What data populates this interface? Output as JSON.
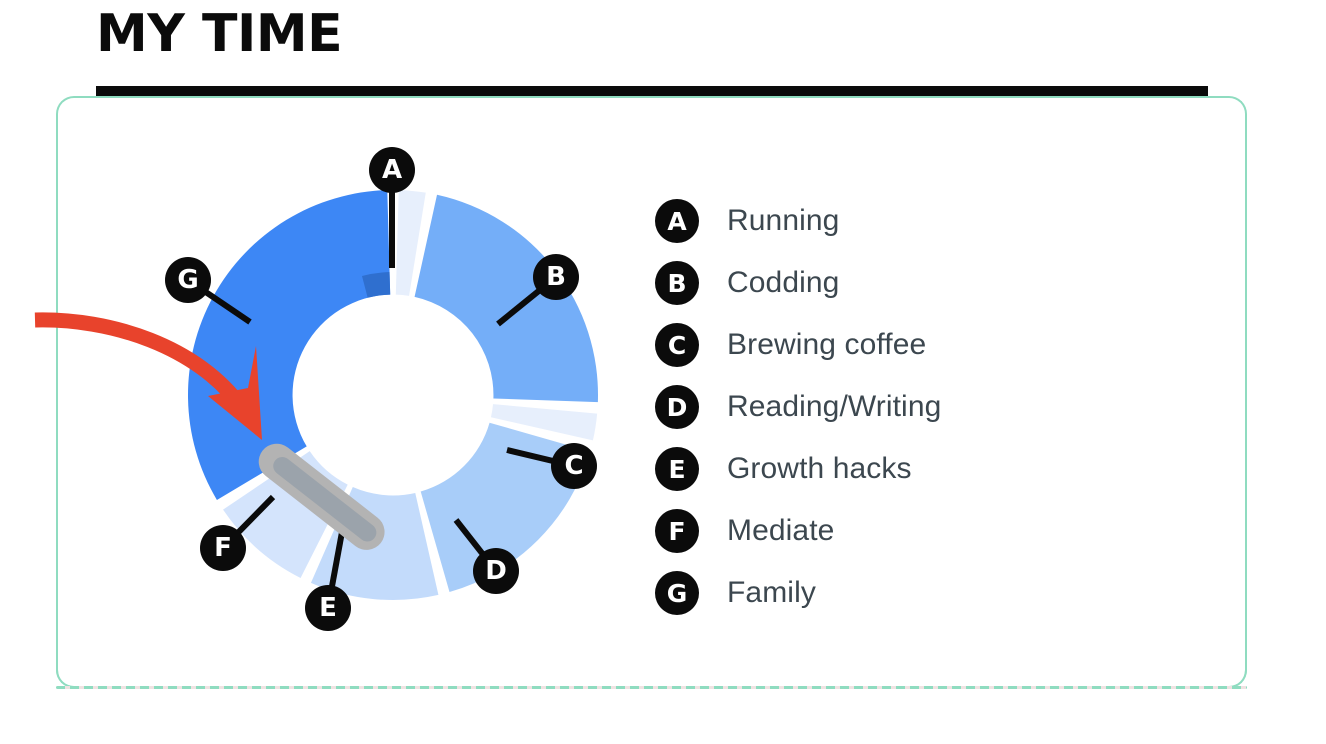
{
  "header": {
    "title": "MY TIME",
    "rule_color": "#0b0b0b"
  },
  "card": {
    "border_color": "#8fdcc0",
    "background": "#ffffff"
  },
  "legend": {
    "text_color": "#3c474f",
    "badge_color": "#0b0b0b",
    "items": [
      {
        "key": "A",
        "label": "Running"
      },
      {
        "key": "B",
        "label": "Codding"
      },
      {
        "key": "C",
        "label": "Brewing coffee"
      },
      {
        "key": "D",
        "label": "Reading/Writing"
      },
      {
        "key": "E",
        "label": "Growth hacks"
      },
      {
        "key": "F",
        "label": "Mediate"
      },
      {
        "key": "G",
        "label": "Family"
      }
    ]
  },
  "annotations": {
    "arrow": {
      "name": "red-curved-arrow",
      "color": "#e8432c",
      "points_to": "F"
    },
    "handle": {
      "name": "drag-handle-pill",
      "color": "#b3b3b3",
      "inner_color": "#8d9aa6",
      "at_boundary": "G/F"
    }
  },
  "chart_data": {
    "type": "pie",
    "title": "MY TIME",
    "variant": "donut",
    "legend_position": "right",
    "start_angle_deg": -90,
    "gap_deg": 3.2,
    "inner_radius_ratio": 0.49,
    "categories": [
      "Running",
      "Codding",
      "Brewing coffee",
      "Reading/Writing",
      "Growth hacks",
      "Mediate",
      "Family"
    ],
    "keys": [
      "A",
      "B",
      "C",
      "D",
      "E",
      "F",
      "G"
    ],
    "values": [
      3,
      23,
      3,
      17,
      11,
      9,
      34
    ],
    "unit": "%",
    "colors": [
      "#e7effc",
      "#74aef8",
      "#e7effc",
      "#a8cdf9",
      "#c3dbfb",
      "#d4e4fc",
      "#3d87f5"
    ],
    "slices": [
      {
        "key": "A",
        "label": "Running",
        "value": 3,
        "color": "#e7effc",
        "start_deg": -90,
        "end_deg": -79.2
      },
      {
        "key": "B",
        "label": "Codding",
        "value": 23,
        "color": "#74aef8",
        "start_deg": -79.2,
        "end_deg": 3.6
      },
      {
        "key": "C",
        "label": "Brewing coffee",
        "value": 3,
        "color": "#e7effc",
        "start_deg": 3.6,
        "end_deg": 14.4
      },
      {
        "key": "D",
        "label": "Reading/Writing",
        "value": 17,
        "color": "#a8cdf9",
        "start_deg": 14.4,
        "end_deg": 75.6
      },
      {
        "key": "E",
        "label": "Growth hacks",
        "value": 11,
        "color": "#c3dbfb",
        "start_deg": 75.6,
        "end_deg": 115.2
      },
      {
        "key": "F",
        "label": "Mediate",
        "value": 9,
        "color": "#d4e4fc",
        "start_deg": 115.2,
        "end_deg": 147.6
      },
      {
        "key": "G",
        "label": "Family",
        "value": 34,
        "color": "#3d87f5",
        "start_deg": 147.6,
        "end_deg": 270
      }
    ]
  }
}
